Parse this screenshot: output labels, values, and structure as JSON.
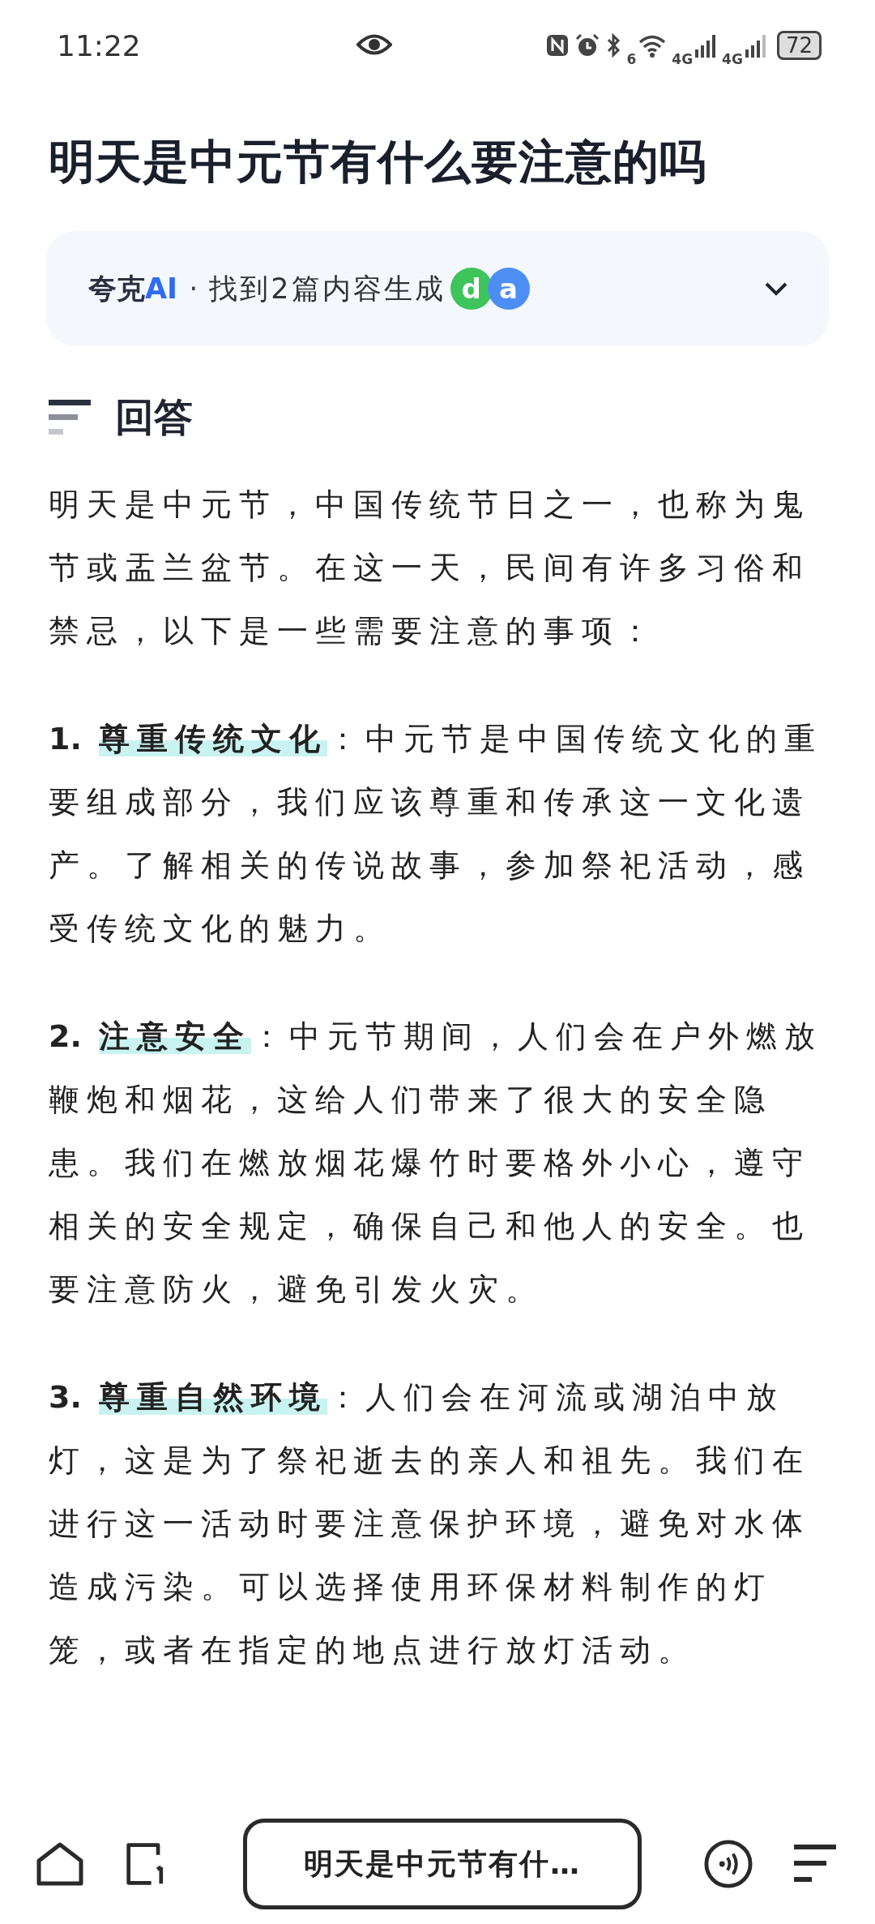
{
  "status_bar": {
    "time": "11:22",
    "wifi_badge": "6",
    "sim1": "4G",
    "sim2": "4G",
    "battery": "72"
  },
  "title": "明天是中元节有什么要注意的吗",
  "source": {
    "brand": "夸克",
    "brand_ai": "AI",
    "separator": "·",
    "summary": "找到2篇内容生成",
    "avatars": [
      {
        "letter": "d",
        "color": "#3dc45a"
      },
      {
        "letter": "a",
        "color": "#4d8ef5"
      }
    ]
  },
  "answer": {
    "heading": "回答",
    "intro": "明天是中元节，中国传统节日之一，也称为鬼节或盂兰盆节。在这一天，民间有许多习俗和禁忌，以下是一些需要注意的事项：",
    "items": [
      {
        "number": "1.",
        "term": "尊重传统文化",
        "text": "：中元节是中国传统文化的重要组成部分，我们应该尊重和传承这一文化遗产。了解相关的传说故事，参加祭祀活动，感受传统文化的魅力。"
      },
      {
        "number": "2.",
        "term": "注意安全",
        "text": "：中元节期间，人们会在户外燃放鞭炮和烟花，这给人们带来了很大的安全隐患。我们在燃放烟花爆竹时要格外小心，遵守相关的安全规定，确保自己和他人的安全。也要注意防火，避免引发火灾。"
      },
      {
        "number": "3.",
        "term": "尊重自然环境",
        "text": "：人们会在河流或湖泊中放灯，这是为了祭祀逝去的亲人和祖先。我们在进行这一活动时要注意保护环境，避免对水体造成污染。可以选择使用环保材料制作的灯笼，或者在指定的地点进行放灯活动。"
      }
    ]
  },
  "bottom_bar": {
    "query": "明天是中元节有什…"
  }
}
